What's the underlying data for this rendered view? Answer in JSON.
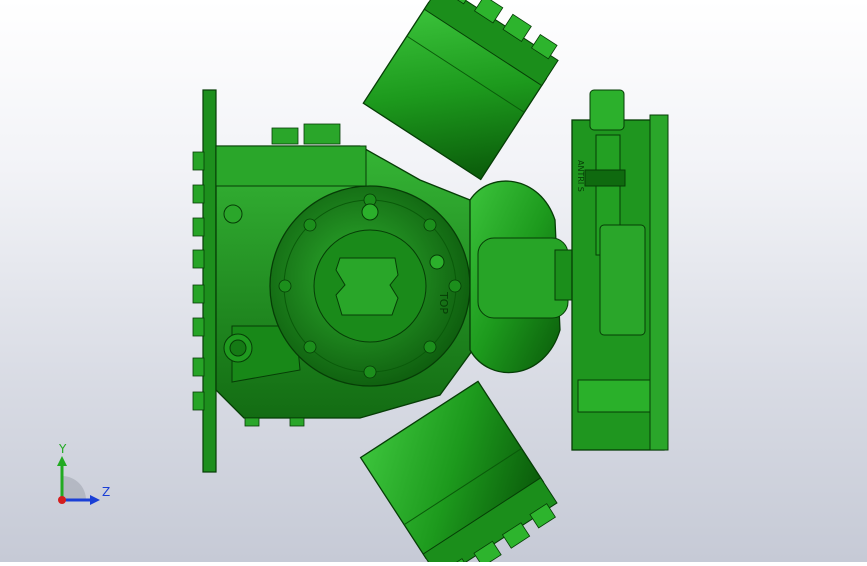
{
  "view": {
    "background_top": "#ffffff",
    "background_bottom": "#c6cad6",
    "model_color": "#1f9a1f"
  },
  "triad": {
    "y_label": "Y",
    "z_label": "Z",
    "y_color": "#22aa22",
    "z_color": "#1a3fd6",
    "x_color": "#d41e1e"
  },
  "model": {
    "rotated_label_1": "TOP",
    "rotated_label_2": "ANTRI S",
    "icon": "compressor-3d-model"
  }
}
